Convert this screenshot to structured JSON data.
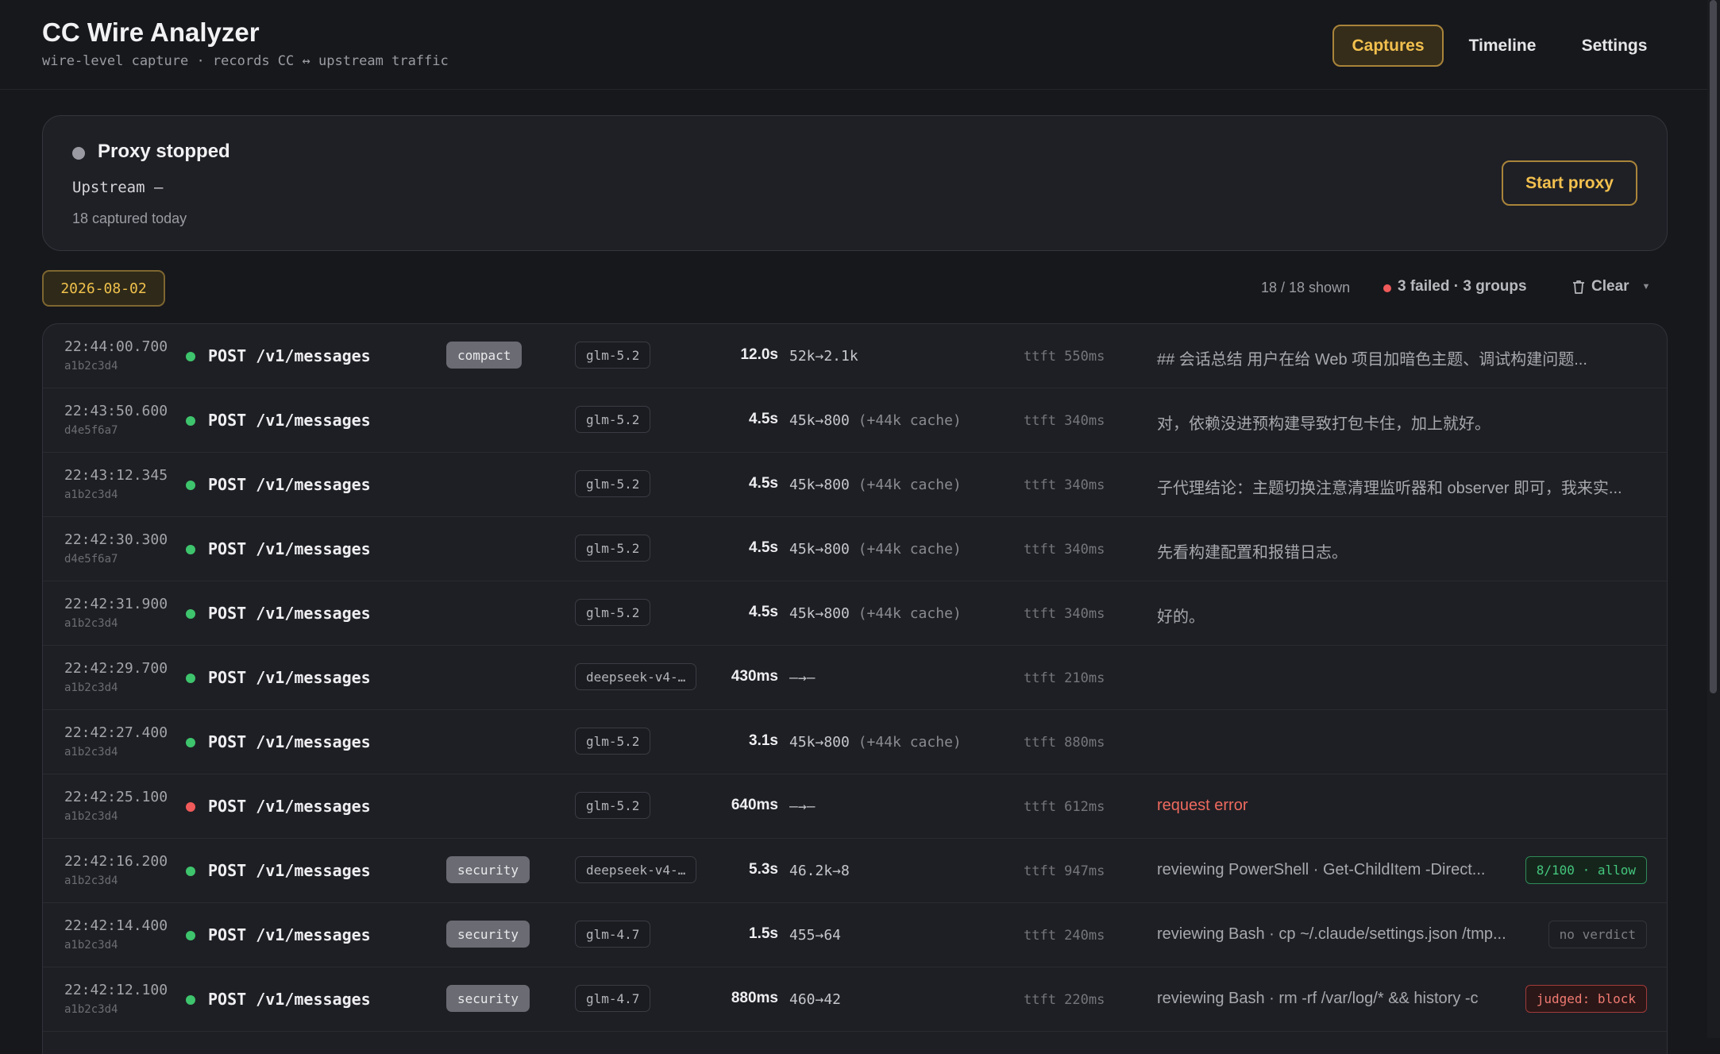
{
  "app": {
    "title": "CC Wire Analyzer",
    "subtitle": "wire-level capture · records CC ↔ upstream traffic"
  },
  "nav": {
    "captures": "Captures",
    "timeline": "Timeline",
    "settings": "Settings",
    "active": "Captures"
  },
  "proxy": {
    "status": "Proxy stopped",
    "upstream": "Upstream —",
    "captured": "18 captured today",
    "start_label": "Start proxy"
  },
  "filters": {
    "date": "2026-08-02",
    "shown": "18 / 18 shown",
    "failed": "3 failed · 3 groups",
    "clear_label": "Clear"
  },
  "colors": {
    "ok": "#3ec46d",
    "error": "#f05a5a",
    "accent": "#f2c04e"
  },
  "rows": [
    {
      "ts": "22:44:00.700",
      "id": "a1b2c3d4",
      "status": "ok",
      "method": "POST /v1/messages",
      "tag": "compact",
      "model": "glm-5.2",
      "duration": "12.0s",
      "tokens": "52k→2.1k",
      "cache": "",
      "ttft": "ttft 550ms",
      "preview": "## 会话总结 用户在给 Web 项目加暗色主题、调试构建问题...",
      "verdict": ""
    },
    {
      "ts": "22:43:50.600",
      "id": "d4e5f6a7",
      "status": "ok",
      "method": "POST /v1/messages",
      "tag": "",
      "model": "glm-5.2",
      "duration": "4.5s",
      "tokens": "45k→800",
      "cache": "(+44k cache)",
      "ttft": "ttft 340ms",
      "preview": "对，依赖没进预构建导致打包卡住，加上就好。",
      "verdict": ""
    },
    {
      "ts": "22:43:12.345",
      "id": "a1b2c3d4",
      "status": "ok",
      "method": "POST /v1/messages",
      "tag": "",
      "model": "glm-5.2",
      "duration": "4.5s",
      "tokens": "45k→800",
      "cache": "(+44k cache)",
      "ttft": "ttft 340ms",
      "preview": "子代理结论：主题切换注意清理监听器和 observer 即可，我来实...",
      "verdict": ""
    },
    {
      "ts": "22:42:30.300",
      "id": "d4e5f6a7",
      "status": "ok",
      "method": "POST /v1/messages",
      "tag": "",
      "model": "glm-5.2",
      "duration": "4.5s",
      "tokens": "45k→800",
      "cache": "(+44k cache)",
      "ttft": "ttft 340ms",
      "preview": "先看构建配置和报错日志。",
      "verdict": ""
    },
    {
      "ts": "22:42:31.900",
      "id": "a1b2c3d4",
      "status": "ok",
      "method": "POST /v1/messages",
      "tag": "",
      "model": "glm-5.2",
      "duration": "4.5s",
      "tokens": "45k→800",
      "cache": "(+44k cache)",
      "ttft": "ttft 340ms",
      "preview": "好的。",
      "verdict": ""
    },
    {
      "ts": "22:42:29.700",
      "id": "a1b2c3d4",
      "status": "ok",
      "method": "POST /v1/messages",
      "tag": "",
      "model": "deepseek-v4-…",
      "duration": "430ms",
      "tokens": "—→—",
      "cache": "",
      "ttft": "ttft 210ms",
      "preview": "",
      "verdict": ""
    },
    {
      "ts": "22:42:27.400",
      "id": "a1b2c3d4",
      "status": "ok",
      "method": "POST /v1/messages",
      "tag": "",
      "model": "glm-5.2",
      "duration": "3.1s",
      "tokens": "45k→800",
      "cache": "(+44k cache)",
      "ttft": "ttft 880ms",
      "preview": "",
      "verdict": ""
    },
    {
      "ts": "22:42:25.100",
      "id": "a1b2c3d4",
      "status": "error",
      "method": "POST /v1/messages",
      "tag": "",
      "model": "glm-5.2",
      "duration": "640ms",
      "tokens": "—→—",
      "cache": "",
      "ttft": "ttft 612ms",
      "preview": "request error",
      "verdict": ""
    },
    {
      "ts": "22:42:16.200",
      "id": "a1b2c3d4",
      "status": "ok",
      "method": "POST /v1/messages",
      "tag": "security",
      "model": "deepseek-v4-…",
      "duration": "5.3s",
      "tokens": "46.2k→8",
      "cache": "",
      "ttft": "ttft 947ms",
      "preview": "reviewing PowerShell · Get-ChildItem -Direct...",
      "verdict": "8/100 · allow",
      "verdict_type": "allow"
    },
    {
      "ts": "22:42:14.400",
      "id": "a1b2c3d4",
      "status": "ok",
      "method": "POST /v1/messages",
      "tag": "security",
      "model": "glm-4.7",
      "duration": "1.5s",
      "tokens": "455→64",
      "cache": "",
      "ttft": "ttft 240ms",
      "preview": "reviewing Bash · cp ~/.claude/settings.json /tmp...",
      "verdict": "no verdict",
      "verdict_type": "none"
    },
    {
      "ts": "22:42:12.100",
      "id": "a1b2c3d4",
      "status": "ok",
      "method": "POST /v1/messages",
      "tag": "security",
      "model": "glm-4.7",
      "duration": "880ms",
      "tokens": "460→42",
      "cache": "",
      "ttft": "ttft 220ms",
      "preview": "reviewing Bash · rm -rf /var/log/* && history -c",
      "verdict": "judged: block",
      "verdict_type": "block"
    }
  ]
}
